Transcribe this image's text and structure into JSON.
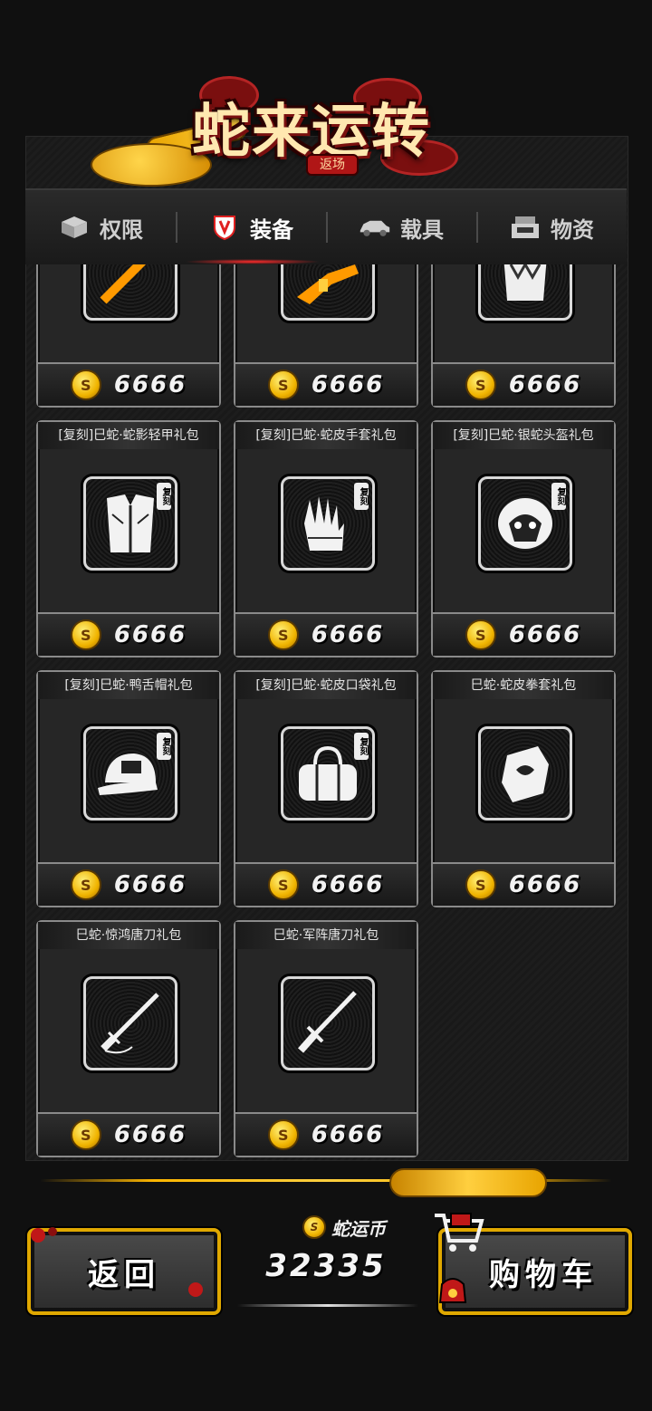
{
  "event": {
    "title": "蛇来运转",
    "badge": "返场"
  },
  "tabs": [
    {
      "label": "权限",
      "icon": "box-icon",
      "active": false
    },
    {
      "label": "装备",
      "icon": "shield-icon",
      "active": true
    },
    {
      "label": "载具",
      "icon": "car-icon",
      "active": false
    },
    {
      "label": "物资",
      "icon": "cash-register-icon",
      "active": false
    }
  ],
  "items": [
    {
      "name": "",
      "price": "6666",
      "icon": "golden-staff-icon",
      "reprint": false
    },
    {
      "name": "",
      "price": "6666",
      "icon": "golden-rifle-icon",
      "reprint": false
    },
    {
      "name": "",
      "price": "6666",
      "icon": "snake-armor-icon",
      "reprint": false
    },
    {
      "name": "[复刻]巳蛇·蛇影轻甲礼包",
      "price": "6666",
      "icon": "light-armor-icon",
      "reprint": true,
      "reprint_label": "复刻"
    },
    {
      "name": "[复刻]巳蛇·蛇皮手套礼包",
      "price": "6666",
      "icon": "gloves-icon",
      "reprint": true,
      "reprint_label": "复刻"
    },
    {
      "name": "[复刻]巳蛇·银蛇头盔礼包",
      "price": "6666",
      "icon": "helmet-icon",
      "reprint": true,
      "reprint_label": "复刻"
    },
    {
      "name": "[复刻]巳蛇·鸭舌帽礼包",
      "price": "6666",
      "icon": "cap-icon",
      "reprint": true,
      "reprint_label": "复刻"
    },
    {
      "name": "[复刻]巳蛇·蛇皮口袋礼包",
      "price": "6666",
      "icon": "bag-icon",
      "reprint": true,
      "reprint_label": "复刻"
    },
    {
      "name": "巳蛇·蛇皮拳套礼包",
      "price": "6666",
      "icon": "fist-wrap-icon",
      "reprint": false
    },
    {
      "name": "巳蛇·惊鸿唐刀礼包",
      "price": "6666",
      "icon": "tang-sword-icon",
      "reprint": false
    },
    {
      "name": "巳蛇·军阵唐刀礼包",
      "price": "6666",
      "icon": "army-sword-icon",
      "reprint": false
    }
  ],
  "footer": {
    "back_label": "返回",
    "cart_label": "购物车",
    "currency_label": "蛇运币",
    "currency_value": "32335"
  },
  "colors": {
    "accent_gold": "#ffb700",
    "active_tab_glow": "#ff2b2b",
    "card_border": "#8a8a8a"
  }
}
